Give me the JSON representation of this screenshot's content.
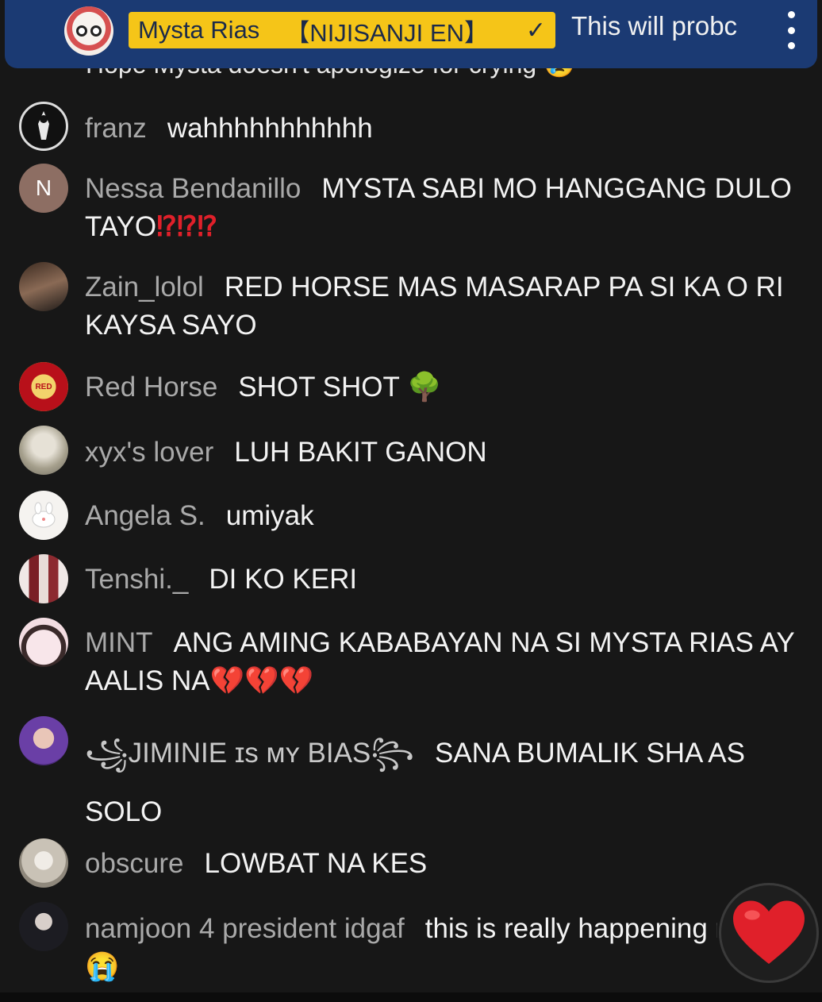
{
  "pinned": {
    "channel_name": "Mysta Rias",
    "channel_tag": "【NIJISANJI EN】",
    "verified_icon": "check-icon",
    "message_preview": "This will probc",
    "menu_icon": "more-vertical-icon"
  },
  "cut_off_message": "Hope Mysta doesn't apologize for crying 😢",
  "messages": [
    {
      "author": "franz",
      "text": "wahhhhhhhhhhh",
      "avatar_icon": "avatar-franz"
    },
    {
      "author": "Nessa Bendanillo",
      "text": "MYSTA SABI MO HANGGANG DULO TAYO",
      "emoji": "⁉⁉⁉",
      "avatar_letter": "N",
      "avatar_color": "#8d6e63"
    },
    {
      "author": "Zain_lolol",
      "text": "RED HORSE MAS MASARAP PA SI KA O RI KAYSA SAYO",
      "avatar_icon": "avatar-zain"
    },
    {
      "author": "Red Horse",
      "text": "SHOT SHOT",
      "emoji": "🌳",
      "avatar_icon": "avatar-red-horse"
    },
    {
      "author": "xyx's lover",
      "text": "LUH BAKIT GANON",
      "avatar_icon": "avatar-xyx"
    },
    {
      "author": "Angela S.",
      "text": "umiyak",
      "avatar_icon": "avatar-angela"
    },
    {
      "author": "Tenshi._",
      "text": "DI KO KERI",
      "avatar_icon": "avatar-tenshi"
    },
    {
      "author": "MINT",
      "text": "ANG AMING KABABAYAN NA SI MYSTA RIAS AY AALIS NA",
      "emoji": "💔💔💔",
      "avatar_icon": "avatar-mint"
    },
    {
      "author": "꧁JIMINIE ɪs ᴍʏ BIAS꧂",
      "text": "SANA BUMALIK SHA AS SOLO",
      "avatar_icon": "avatar-jiminie"
    },
    {
      "author": "obscure",
      "text": "LOWBAT NA KES",
      "avatar_icon": "avatar-obscure"
    },
    {
      "author": "namjoon 4 president idgaf",
      "text": "this is really happening ri",
      "emoji": "😭",
      "avatar_icon": "avatar-namjoon"
    }
  ],
  "reaction_button": {
    "icon": "heart-icon",
    "color": "#e0202a"
  },
  "colors": {
    "background": "#171717",
    "pinned_bg": "#1b3a73",
    "owner_badge": "#f5c518",
    "author": "#a9a9a9"
  }
}
